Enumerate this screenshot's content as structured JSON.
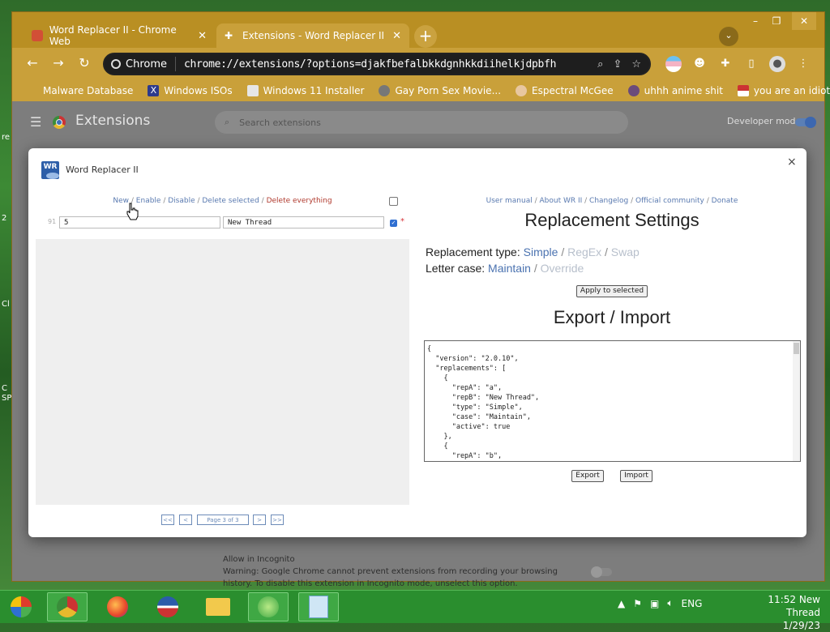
{
  "desktop": {
    "icon_labels": [
      "re",
      "2",
      "Cl",
      "C",
      "SP"
    ]
  },
  "browser": {
    "tabs": [
      {
        "label": "Word Replacer II - Chrome Web",
        "active": false,
        "icon": "chrome-web-store-icon"
      },
      {
        "label": "Extensions - Word Replacer II",
        "active": true,
        "icon": "puzzle-icon"
      }
    ],
    "window_controls": {
      "minimize": "–",
      "maximize": "❐",
      "close": "✕"
    },
    "omnibox": {
      "site_chip": "Chrome",
      "url": "chrome://extensions/?options=djakfbefalbkkdgnhkkdiihelkjdpbfh"
    },
    "bookmarks": [
      "Malware Database",
      "Windows ISOs",
      "Windows 11 Installer",
      "Gay Porn Sex Movie...",
      "Espectral McGee",
      "uhhh anime shit",
      "you are an idiot!"
    ]
  },
  "extensions_page": {
    "title": "Extensions",
    "search_placeholder": "Search extensions",
    "developer_mode_label": "Developer mode",
    "incognito_title": "Allow in Incognito",
    "incognito_warning": "Warning: Google Chrome cannot prevent extensions from recording your browsing history. To disable this extension in Incognito mode, unselect this option."
  },
  "dialog": {
    "title": "Word Replacer II",
    "logo_text": "WR",
    "close": "×",
    "left": {
      "actions": {
        "new": "New",
        "enable": "Enable",
        "disable": "Disable",
        "delete_selected": "Delete selected",
        "delete_everything": "Delete everything",
        "separator": " / "
      },
      "row": {
        "number": "91",
        "rep_a": "5",
        "rep_b": "New Thread",
        "checked": true,
        "marker": "*"
      },
      "pager": {
        "first": "<<",
        "prev": "<",
        "page": "Page 3 of 3",
        "next": ">",
        "last": ">>"
      }
    },
    "right": {
      "links": [
        "User manual",
        "About WR II",
        "Changelog",
        "Official community",
        "Donate"
      ],
      "settings_title": "Replacement Settings",
      "type_label": "Replacement type:",
      "type_options": [
        "Simple",
        "RegEx",
        "Swap"
      ],
      "case_label": "Letter case:",
      "case_options": [
        "Maintain",
        "Override"
      ],
      "apply_button": "Apply to selected",
      "export_title": "Export / Import",
      "json_text": "{\n  \"version\": \"2.0.10\",\n  \"replacements\": [\n    {\n      \"repA\": \"a\",\n      \"repB\": \"New Thread\",\n      \"type\": \"Simple\",\n      \"case\": \"Maintain\",\n      \"active\": true\n    },\n    {\n      \"repA\": \"b\",",
      "export_button": "Export",
      "import_button": "Import"
    }
  },
  "taskbar": {
    "apps": [
      "start-orb",
      "chrome",
      "firefox",
      "internet-explorer",
      "file-explorer",
      "app-green",
      "notepad"
    ],
    "tray_lang": "ENG",
    "clock_time": "11:52 New Thread",
    "clock_date": "1/29/23"
  },
  "colors": {
    "chrome_frame": "#c9a03a",
    "link": "#5a7ab0",
    "danger": "#b03a2e",
    "accent_blue": "#2f6fd1"
  }
}
